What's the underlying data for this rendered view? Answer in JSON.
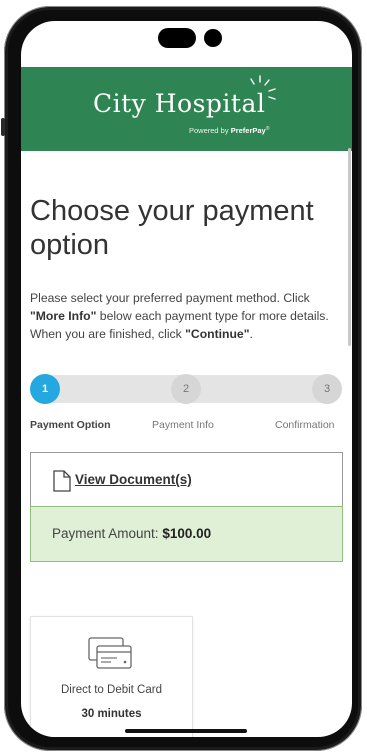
{
  "header": {
    "brand": "City Hospital",
    "powered_prefix": "Powered by ",
    "powered_brand": "PreferPay",
    "powered_mark": "®",
    "bg_color": "#2e8452"
  },
  "page": {
    "title": "Choose your payment option",
    "desc_part1": "Please select your preferred payment method. Click ",
    "desc_more_info": "\"More Info\"",
    "desc_part2": " below each payment type for more details. When you are finished, click ",
    "desc_continue": "\"Continue\"",
    "desc_part3": "."
  },
  "steps": [
    {
      "number": "1",
      "label": "Payment Option",
      "active": true
    },
    {
      "number": "2",
      "label": "Payment Info",
      "active": false
    },
    {
      "number": "3",
      "label": "Confirmation",
      "active": false
    }
  ],
  "documents": {
    "link_label": "View Document(s)",
    "icon": "document-icon"
  },
  "amount": {
    "label": "Payment Amount: ",
    "value": "$100.00"
  },
  "payment_options": [
    {
      "label": "Direct to Debit Card",
      "time": "30 minutes",
      "icon": "debit-card-icon"
    }
  ],
  "colors": {
    "accent": "#25a8e0",
    "amount_bg": "#dff0d6",
    "amount_border": "#8fc17a"
  }
}
